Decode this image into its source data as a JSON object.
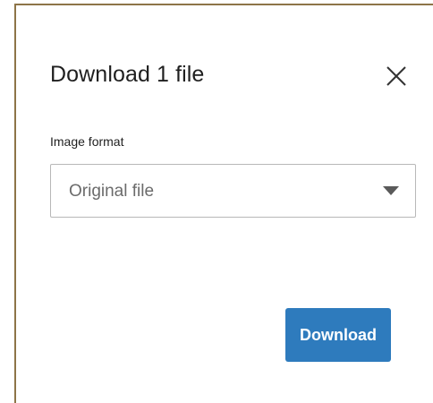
{
  "dialog": {
    "title": "Download 1 file",
    "close_icon": "close-icon",
    "format_field": {
      "label": "Image format",
      "selected_value": "Original file",
      "arrow_icon": "dropdown-arrow-icon"
    },
    "download_label": "Download"
  },
  "colors": {
    "accent": "#2e7bbd",
    "frame_border": "#8d7448",
    "title_text": "#1f1f1f",
    "select_text": "#6b6b6b"
  }
}
